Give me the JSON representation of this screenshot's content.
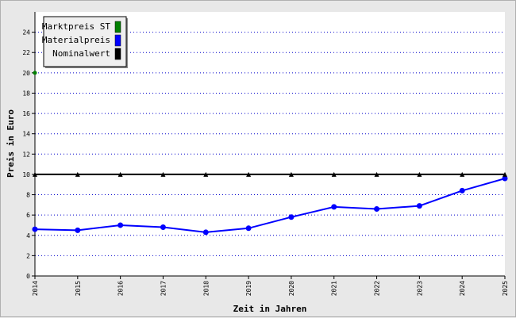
{
  "chart_data": {
    "type": "line",
    "xlabel": "Zeit in Jahren",
    "ylabel": "Preis in Euro",
    "x": [
      "2014",
      "2015",
      "2016",
      "2017",
      "2018",
      "2019",
      "2020",
      "2021",
      "2022",
      "2023",
      "2024",
      "2025"
    ],
    "y_ticks": [
      "0",
      "2",
      "4",
      "6",
      "8",
      "10",
      "12",
      "14",
      "16",
      "18",
      "20",
      "22",
      "24"
    ],
    "ylim": [
      0,
      26
    ],
    "grid": true,
    "legend_position": "top-left",
    "series": [
      {
        "name": "Marktpreis ST",
        "color": "#008000",
        "values": [
          20,
          null,
          null,
          null,
          null,
          null,
          null,
          null,
          null,
          null,
          null,
          null
        ]
      },
      {
        "name": "Materialpreis",
        "color": "#0000ff",
        "values": [
          4.6,
          4.5,
          5.0,
          4.8,
          4.3,
          4.7,
          5.8,
          6.8,
          6.6,
          6.9,
          8.4,
          9.6
        ]
      },
      {
        "name": "Nominalwert",
        "color": "#000000",
        "values": [
          10,
          10,
          10,
          10,
          10,
          10,
          10,
          10,
          10,
          10,
          10,
          10
        ]
      }
    ]
  }
}
